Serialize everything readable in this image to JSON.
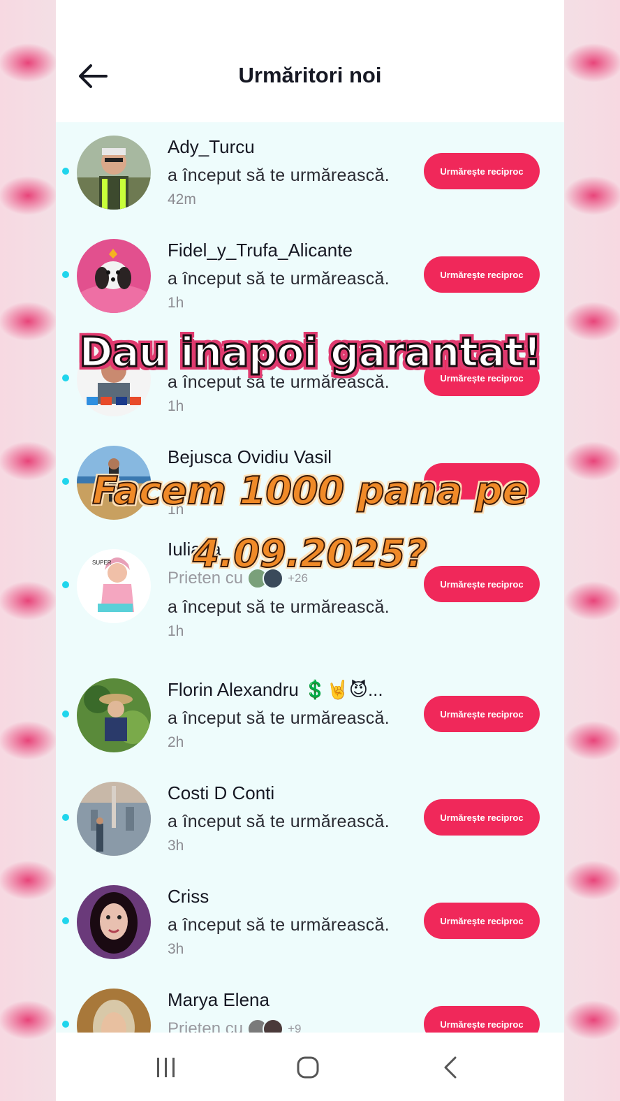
{
  "header": {
    "title": "Urmăritori noi",
    "back_icon": "arrow-left-icon"
  },
  "colors": {
    "accent": "#f0285a",
    "unread_dot": "#20d5ec",
    "list_bg": "#eefcfc"
  },
  "followers": [
    {
      "name": "Ady_Turcu",
      "action": "a început să te urmărească.",
      "time": "42m",
      "button": "Urmărește reciproc"
    },
    {
      "name": "Fidel_y_Trufa_Alicante",
      "action": "a început să te urmărească.",
      "time": "1h",
      "button": "Urmărește reciproc"
    },
    {
      "name": "",
      "action": "a început să te urmărească.",
      "time": "1h",
      "button": "Urmărește reciproc"
    },
    {
      "name": "Bejusca Ovidiu Vasil",
      "action": "",
      "time": "1h",
      "button": ""
    },
    {
      "name": "Iuliana",
      "friends_prefix": "Prieten cu",
      "friends_count": "+26",
      "action": "a început să te urmărească.",
      "time": "1h",
      "button": "Urmărește reciproc"
    },
    {
      "name": "Florin Alexandru 💲🤘😈...",
      "action": "a început să te urmărească.",
      "time": "2h",
      "button": "Urmărește reciproc"
    },
    {
      "name": "Costi D Conti",
      "action": "a început să te urmărească.",
      "time": "3h",
      "button": "Urmărește reciproc"
    },
    {
      "name": "Criss",
      "action": "a început să te urmărească.",
      "time": "3h",
      "button": "Urmărește reciproc"
    },
    {
      "name": "Marya Elena",
      "friends_prefix": "Prieten cu",
      "friends_count": "+9",
      "button": "Urmărește reciproc"
    }
  ],
  "overlay": {
    "line1": "Dau inapoi garantat!",
    "line2": "Facem 1000 pana pe",
    "line3": "4.09.2025?"
  },
  "navbar": {
    "recents_icon": "recents-icon",
    "home_icon": "home-icon",
    "back_icon": "nav-back-icon"
  }
}
